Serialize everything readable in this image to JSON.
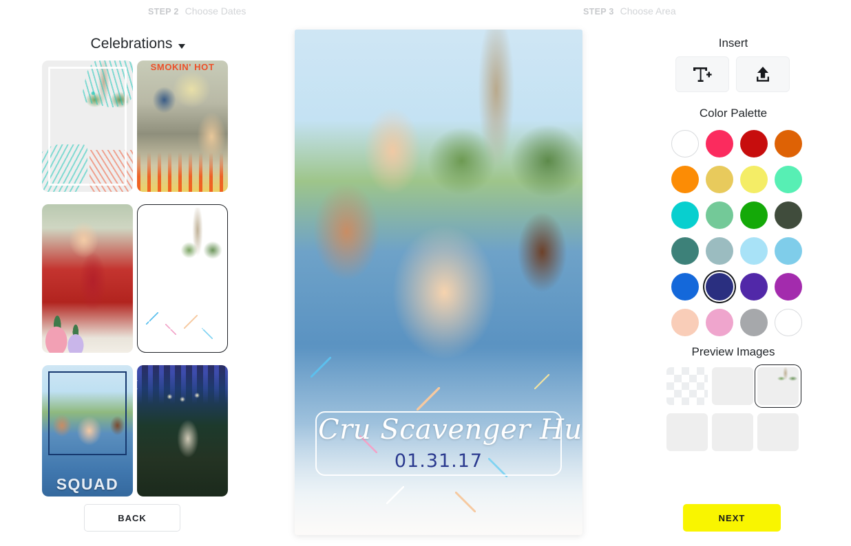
{
  "stepper": {
    "steps": [
      {
        "num": "STEP 2",
        "label": "Choose Dates"
      },
      {
        "num": "STEP 3",
        "label": "Choose Area"
      }
    ]
  },
  "left_panel": {
    "category": {
      "label": "Celebrations",
      "caret_icon": "chevron-down-icon"
    },
    "templates": [
      {
        "name": "tropical-fronds-selfie",
        "selected": false
      },
      {
        "name": "bbq-flames-food",
        "overlay_text": "SMOKIN' HOT",
        "selected": false
      },
      {
        "name": "plants-high-five",
        "selected": false
      },
      {
        "name": "confetti-selfie",
        "selected": true
      },
      {
        "name": "squad-frame-selfie",
        "overlay_text": "SQUAD",
        "selected": false
      },
      {
        "name": "string-lights-evening",
        "selected": false
      }
    ],
    "back_button": "BACK"
  },
  "canvas": {
    "title": "Cru Scavenger Hunt",
    "date": "01.31.17",
    "photo_name": "group-selfie-palm-trees"
  },
  "right_panel": {
    "insert": {
      "heading": "Insert",
      "buttons": [
        {
          "name": "add-text-button",
          "icon": "text-add-icon"
        },
        {
          "name": "upload-image-button",
          "icon": "upload-icon"
        }
      ]
    },
    "color_palette": {
      "heading": "Color Palette",
      "selected_index": 17,
      "swatches": [
        "#ffffff",
        "#fb2b5e",
        "#c70d0d",
        "#de6205",
        "#fc8c05",
        "#e8ca5c",
        "#f4ed66",
        "#57efb4",
        "#08cfcf",
        "#73c998",
        "#14a908",
        "#404c3c",
        "#3d8179",
        "#9bbcc0",
        "#a8e2f7",
        "#7fcdea",
        "#1468da",
        "#2a2f80",
        "#5128a8",
        "#a32bad",
        "#f9cdb8",
        "#efa5cd",
        "#a6a8ab",
        "#ffffff"
      ]
    },
    "preview_images": {
      "heading": "Preview Images",
      "selected_index": 2,
      "items": [
        {
          "name": "preview-transparent",
          "kind": "transparent"
        },
        {
          "name": "preview-evening-party",
          "kind": "party-night"
        },
        {
          "name": "preview-group-selfie",
          "kind": "selfie"
        },
        {
          "name": "preview-red-jacket-high-five",
          "kind": "highfive"
        },
        {
          "name": "preview-sunglasses-couple",
          "kind": "sunglasses"
        },
        {
          "name": "preview-food-table",
          "kind": "food"
        }
      ]
    },
    "next_button": "NEXT"
  }
}
